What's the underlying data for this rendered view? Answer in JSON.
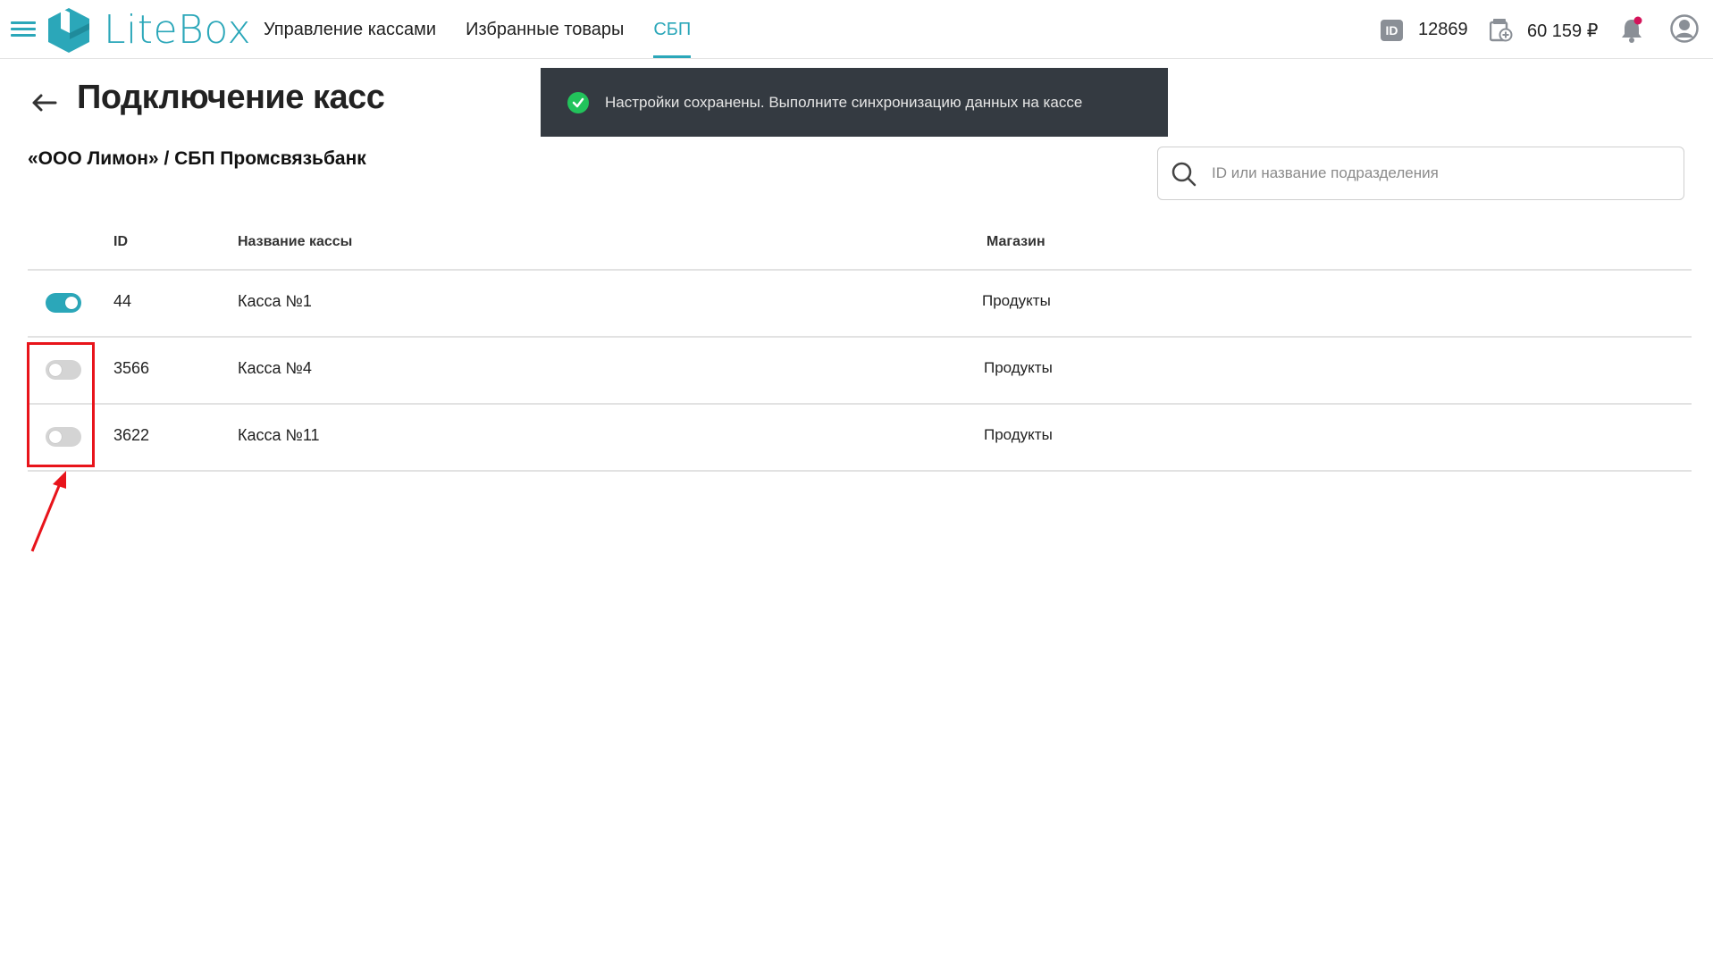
{
  "header": {
    "brand": "LiteBox",
    "nav": [
      {
        "label": "Управление кассами",
        "active": false
      },
      {
        "label": "Избранные товары",
        "active": false
      },
      {
        "label": "СБП",
        "active": true
      }
    ],
    "id_badge": "ID",
    "account_id": "12869",
    "balance": "60 159 ₽",
    "accent_color": "#2ba7b9",
    "notification_dot_color": "#d4145a"
  },
  "toast": {
    "message": "Настройки сохранены. Выполните синхронизацию данных на кассе",
    "icon": "check-circle-icon"
  },
  "page": {
    "title": "Подключение касс",
    "subtitle": "«ООО Лимон» / СБП Промсвязьбанк"
  },
  "search": {
    "placeholder": "ID или название подразделения",
    "value": ""
  },
  "table": {
    "columns": {
      "id": "ID",
      "name": "Название кассы",
      "shop": "Магазин"
    },
    "rows": [
      {
        "enabled": true,
        "id": "44",
        "name": "Касса №1",
        "shop": "Продукты"
      },
      {
        "enabled": false,
        "id": "3566",
        "name": "Касса №4",
        "shop": "Продукты"
      },
      {
        "enabled": false,
        "id": "3622",
        "name": "Касса №11",
        "shop": "Продукты"
      }
    ]
  },
  "annotation": {
    "color": "#e8141b"
  }
}
